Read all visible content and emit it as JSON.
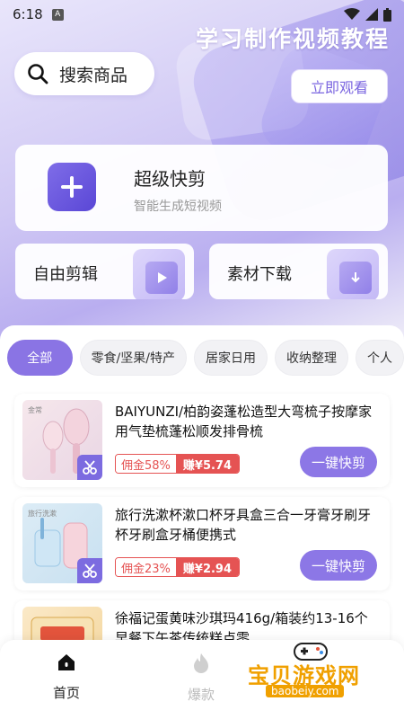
{
  "status_bar": {
    "time": "6:18",
    "badge": "A"
  },
  "banner": {
    "title": "学习制作视频教程",
    "watch_button": "立即观看"
  },
  "search": {
    "placeholder": "搜索商品"
  },
  "main_card": {
    "title": "超级快剪",
    "subtitle": "智能生成短视频"
  },
  "shortcuts": [
    {
      "label": "自由剪辑"
    },
    {
      "label": "素材下载"
    }
  ],
  "categories": [
    {
      "label": "全部",
      "active": true
    },
    {
      "label": "零食/坚果/特产"
    },
    {
      "label": "居家日用"
    },
    {
      "label": "收纳整理"
    },
    {
      "label": "个人"
    }
  ],
  "products": [
    {
      "title": "BAIYUNZI/柏韵姿蓬松造型大弯梳子按摩家用气垫梳蓬松顺发排骨梳",
      "commission": "佣金58%",
      "earn": "赚¥5.74",
      "button": "一键快剪",
      "thumb_caption": "金常"
    },
    {
      "title": "旅行洗漱杯漱口杯牙具盒三合一牙膏牙刷牙杯牙刷盒牙桶便携式",
      "commission": "佣金23%",
      "earn": "赚¥2.94",
      "button": "一键快剪",
      "thumb_caption": "旅行洗漱"
    },
    {
      "title": "徐福记蛋黄味沙琪玛416g/箱装约13-16个早餐下午茶传统糕点零",
      "commission": "",
      "earn": "",
      "button": ""
    }
  ],
  "tabbar": [
    {
      "label": "首页"
    },
    {
      "label": "爆款"
    }
  ],
  "watermark": {
    "text": "宝贝游戏网",
    "url": "baobeiy.com"
  },
  "colors": {
    "accent": "#8a74e4",
    "red": "#e55353"
  }
}
